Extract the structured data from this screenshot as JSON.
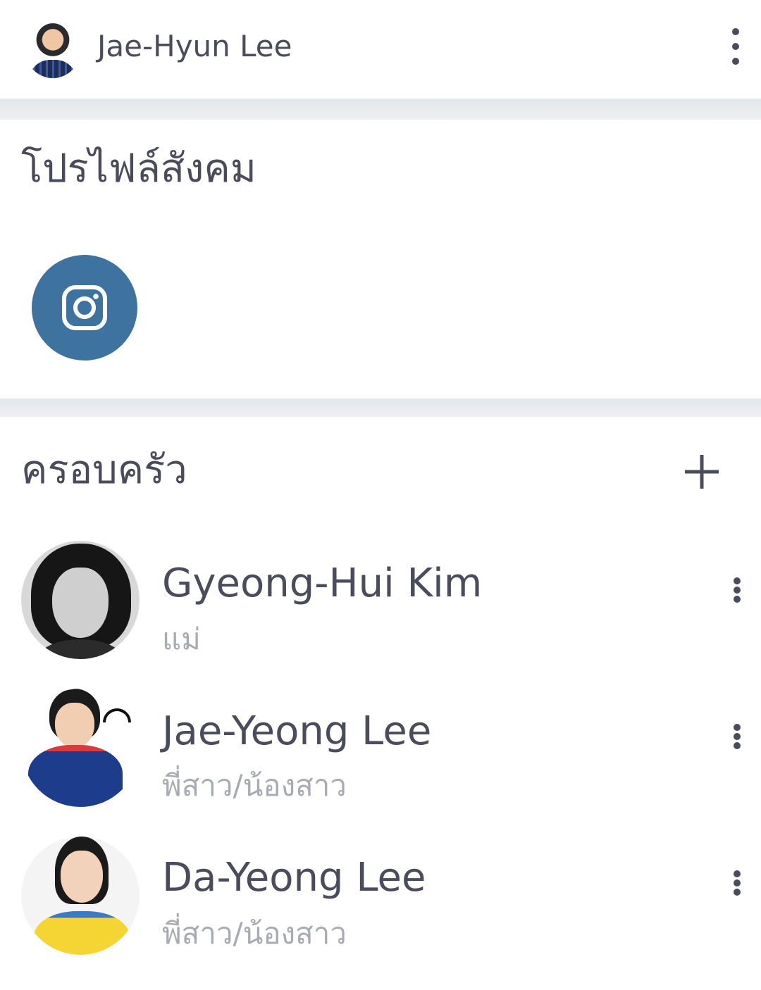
{
  "header": {
    "name": "Jae-Hyun Lee"
  },
  "social": {
    "title": "โปรไฟล์สังคม",
    "links": [
      {
        "icon": "instagram-icon",
        "color": "#3d739e"
      }
    ]
  },
  "family": {
    "title": "ครอบครัว",
    "members": [
      {
        "name": "Gyeong-Hui Kim",
        "relation": "แม่"
      },
      {
        "name": "Jae-Yeong Lee",
        "relation": "พี่สาว/น้องสาว"
      },
      {
        "name": "Da-Yeong Lee",
        "relation": "พี่สาว/น้องสาว"
      }
    ]
  },
  "colors": {
    "text": "#4a4c5c",
    "muted": "#a9abb3",
    "accent": "#3d739e",
    "divider": "#e3e6ea"
  }
}
